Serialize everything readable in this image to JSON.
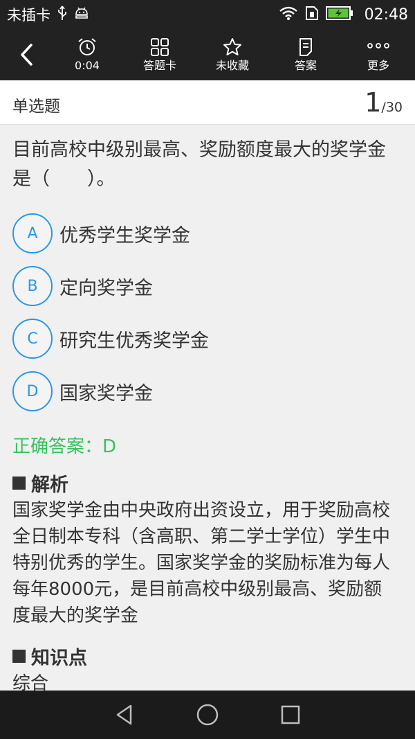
{
  "status_bar": {
    "carrier": "未插卡",
    "time": "02:48",
    "icons": [
      "usb-icon",
      "android-debug-icon",
      "wifi-icon",
      "sim-icon",
      "battery-charging-icon"
    ],
    "battery_color": "#5cc33a"
  },
  "toolbar": {
    "timer": "0:04",
    "answer_card": "答题卡",
    "favorite": "未收藏",
    "answer": "答案",
    "more": "更多"
  },
  "question_header": {
    "type": "单选题",
    "current": "1",
    "total": "/30"
  },
  "question": {
    "text": "目前高校中级别最高、奖励额度最大的奖学金是（　　）。",
    "options": [
      {
        "letter": "A",
        "text": "优秀学生奖学金"
      },
      {
        "letter": "B",
        "text": "定向奖学金"
      },
      {
        "letter": "C",
        "text": "研究生优秀奖学金"
      },
      {
        "letter": "D",
        "text": "国家奖学金"
      }
    ]
  },
  "answer_section": {
    "correct": "正确答案：D",
    "analysis_title": "解析",
    "analysis_text": "国家奖学金由中央政府出资设立，用于奖励高校全日制本专科（含高职、第二学士学位）学生中特别优秀的学生。国家奖学金的奖励标准为每人每年8000元，是目前高校中级别最高、奖励额度最大的奖学金",
    "knowledge_title": "知识点",
    "knowledge_text": "综合"
  },
  "colors": {
    "accent_blue": "#2a97e6",
    "correct_green": "#36c25e",
    "bar_dark": "#222222"
  }
}
